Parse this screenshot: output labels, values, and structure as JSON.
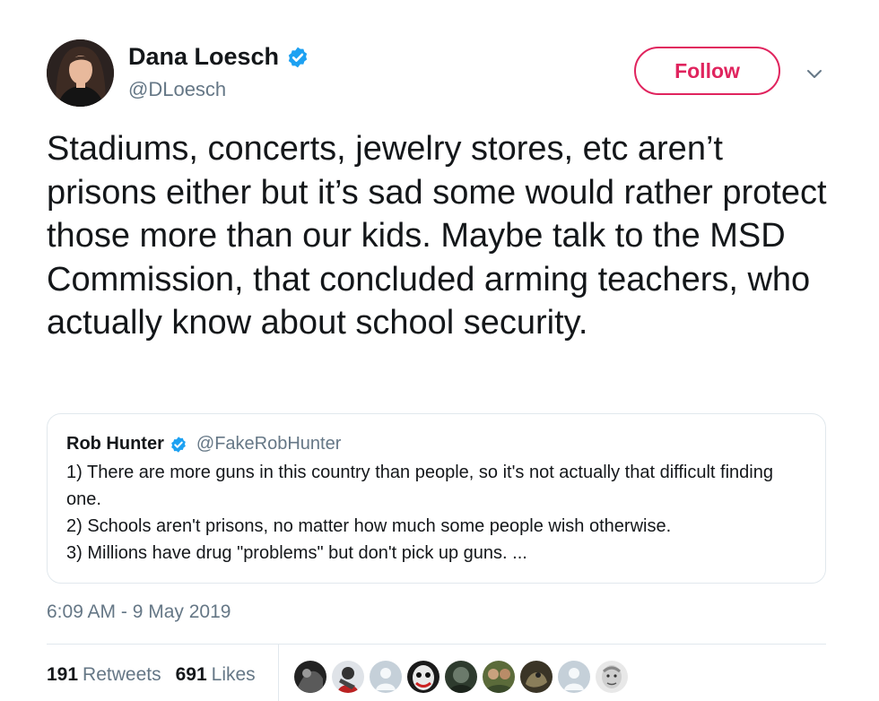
{
  "author": {
    "name": "Dana Loesch",
    "handle": "@DLoesch",
    "verified": true
  },
  "follow_button": {
    "label": "Follow"
  },
  "tweet": {
    "text": "Stadiums, concerts, jewelry stores, etc aren’t prisons either but it’s sad some would rather protect those more than our kids. Maybe talk to the MSD Commission, that concluded arming teachers, who actually know about school security."
  },
  "quoted_tweet": {
    "name": "Rob Hunter",
    "handle": "@FakeRobHunter",
    "verified": true,
    "lines": [
      "1) There are more guns in this country than people, so it's not actually that difficult finding one.",
      "2) Schools aren't prisons, no matter how much some people wish otherwise.",
      "3) Millions have drug \"problems\" but don't pick up guns. ..."
    ]
  },
  "timestamp": "6:09 AM - 9 May 2019",
  "stats": {
    "retweets_count": "191",
    "retweets_label": "Retweets",
    "likes_count": "691",
    "likes_label": "Likes"
  },
  "colors": {
    "follow_accent": "#e0245e",
    "verified_blue": "#1da1f2",
    "secondary_text": "#657786",
    "border": "#e1e8ed"
  },
  "icons": [
    "verified-badge-icon",
    "caret-down-icon",
    "default-avatar-icon"
  ]
}
